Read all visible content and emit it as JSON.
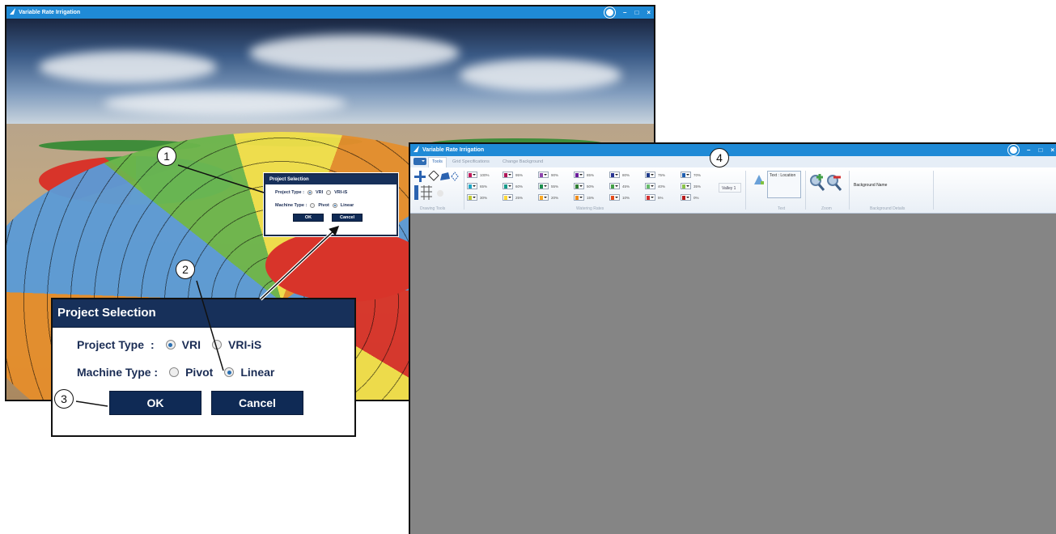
{
  "app_title": "Variable Rate Irrigation",
  "small_dialog": {
    "title": "Project Selection",
    "project_type_label": "Project Type :",
    "project_options": [
      "VRI",
      "VRI-iS"
    ],
    "project_selected": "VRI",
    "machine_type_label": "Machine Type :",
    "machine_options": [
      "Pivot",
      "Linear"
    ],
    "machine_selected": "Linear",
    "ok_label": "OK",
    "cancel_label": "Cancel"
  },
  "big_dialog": {
    "title": "Project Selection",
    "project_type_label": "Project Type",
    "project_type_colon": ":",
    "project_options": [
      "VRI",
      "VRI-iS"
    ],
    "project_selected": "VRI",
    "machine_type_label": "Machine Type :",
    "machine_options": [
      "Pivot",
      "Linear"
    ],
    "machine_selected": "Linear",
    "ok_label": "OK",
    "cancel_label": "Cancel"
  },
  "ribbon": {
    "tabs": [
      "Tools",
      "Grid Specifications",
      "Change Background"
    ],
    "active_tab": "Tools",
    "groups": {
      "drawing_tools": "Drawing Tools",
      "watering_rates": "Watering Rates",
      "text": "Text",
      "zoom": "Zoom",
      "background_details": "Background Details"
    },
    "watering_rates": [
      {
        "pct": "100%",
        "color": "#c2185b"
      },
      {
        "pct": "95%",
        "color": "#ad1457"
      },
      {
        "pct": "90%",
        "color": "#8e44ad"
      },
      {
        "pct": "85%",
        "color": "#6a1b9a"
      },
      {
        "pct": "80%",
        "color": "#283593"
      },
      {
        "pct": "75%",
        "color": "#1e3a8a"
      },
      {
        "pct": "70%",
        "color": "#1f5fb0"
      },
      {
        "pct": "65%",
        "color": "#1ea7c7"
      },
      {
        "pct": "60%",
        "color": "#159a8a"
      },
      {
        "pct": "55%",
        "color": "#1b8f4f"
      },
      {
        "pct": "50%",
        "color": "#2e7d32"
      },
      {
        "pct": "45%",
        "color": "#43a047"
      },
      {
        "pct": "40%",
        "color": "#66bb6a"
      },
      {
        "pct": "35%",
        "color": "#8bc34a"
      },
      {
        "pct": "30%",
        "color": "#c0ca33"
      },
      {
        "pct": "25%",
        "color": "#fdd835"
      },
      {
        "pct": "20%",
        "color": "#f9a825"
      },
      {
        "pct": "15%",
        "color": "#ef8c1a"
      },
      {
        "pct": "10%",
        "color": "#e64a19"
      },
      {
        "pct": "5%",
        "color": "#d32f2f"
      },
      {
        "pct": "0%",
        "color": "#b71c1c"
      }
    ],
    "valley_value": "Valley 1",
    "text_location": "Text : Location",
    "background_name": "Background Name"
  },
  "callouts": [
    "1",
    "2",
    "3",
    "4"
  ]
}
